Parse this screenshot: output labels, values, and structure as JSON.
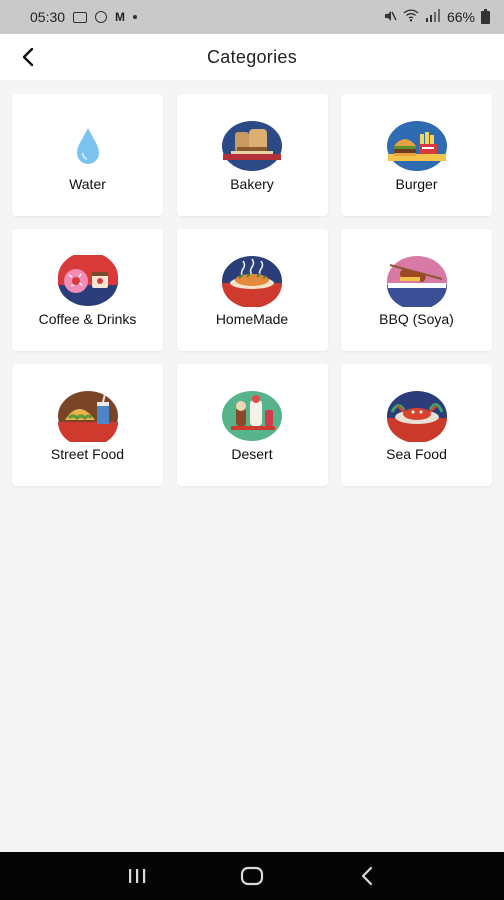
{
  "status_bar": {
    "time": "05:30",
    "battery": "66%"
  },
  "header": {
    "title": "Categories",
    "back_icon": "back-arrow-icon"
  },
  "categories": [
    {
      "label": "Water",
      "icon": "water-drop-icon"
    },
    {
      "label": "Bakery",
      "icon": "bakery-icon"
    },
    {
      "label": "Burger",
      "icon": "burger-icon"
    },
    {
      "label": "Coffee & Drinks",
      "icon": "coffee-drinks-icon"
    },
    {
      "label": "HomeMade",
      "icon": "homemade-food-icon"
    },
    {
      "label": "BBQ (Soya)",
      "icon": "bbq-icon"
    },
    {
      "label": "Street Food",
      "icon": "street-food-icon"
    },
    {
      "label": "Desert",
      "icon": "dessert-icon"
    },
    {
      "label": "Sea Food",
      "icon": "seafood-icon"
    }
  ],
  "nav": {
    "recent_icon": "recent-apps-icon",
    "home_icon": "home-icon",
    "back_icon": "nav-back-icon"
  },
  "colors": {
    "status_bar_bg": "#c9c9c9",
    "page_bg": "#f5f5f5",
    "card_bg": "#ffffff",
    "nav_bar_bg": "#050505"
  }
}
